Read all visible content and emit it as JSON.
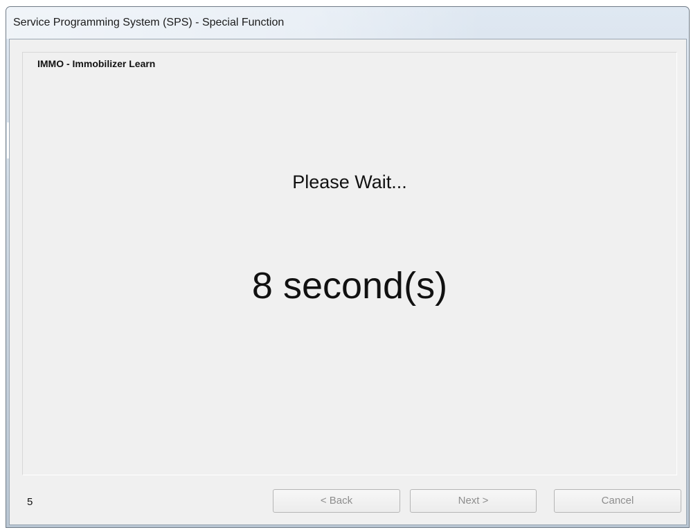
{
  "window": {
    "title": "Service Programming System (SPS) - Special Function"
  },
  "group": {
    "title": "IMMO - Immobilizer Learn"
  },
  "main": {
    "status_text": "Please Wait...",
    "countdown_text": "8 second(s)"
  },
  "footer": {
    "step_number": "5",
    "back_label": "< Back",
    "next_label": "Next >",
    "cancel_label": "Cancel"
  }
}
